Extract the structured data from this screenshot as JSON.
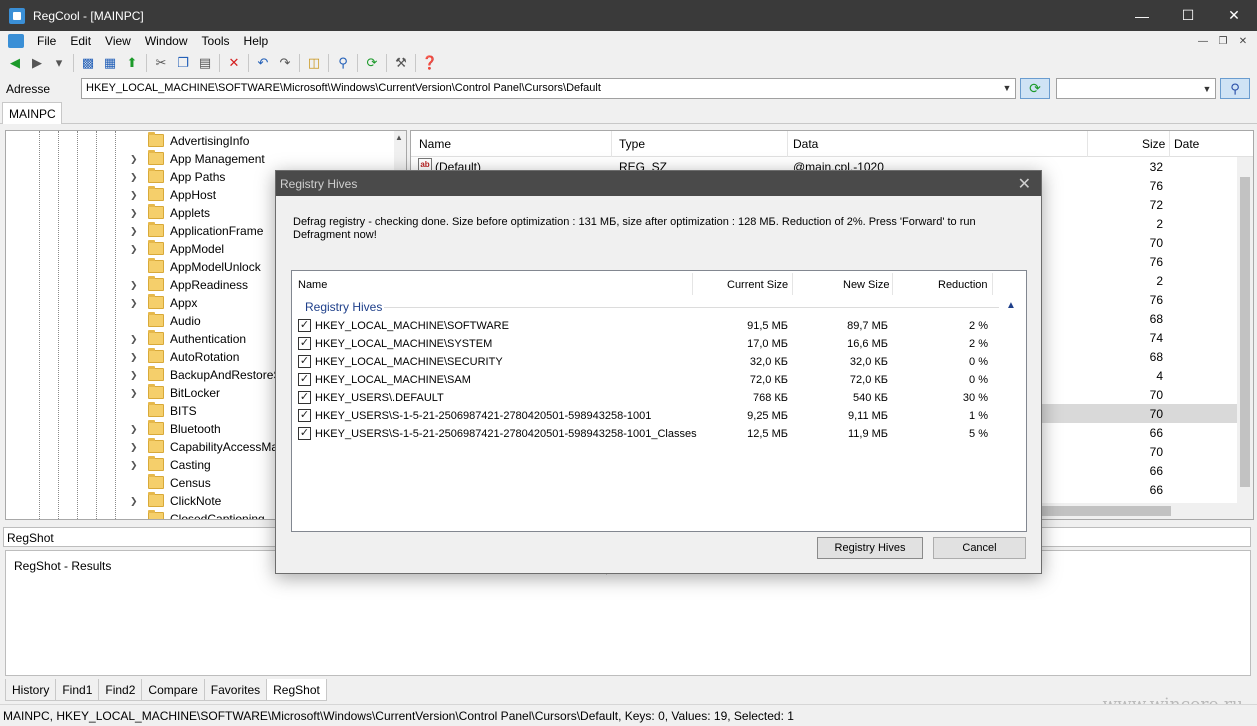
{
  "window": {
    "title": "RegCool - [MAINPC]",
    "controls": [
      "minimize-icon",
      "maximize-icon",
      "close-icon"
    ]
  },
  "menu": {
    "items": [
      "File",
      "Edit",
      "View",
      "Window",
      "Tools",
      "Help"
    ]
  },
  "address": {
    "label": "Adresse",
    "value": "HKEY_LOCAL_MACHINE\\SOFTWARE\\Microsoft\\Windows\\CurrentVersion\\Control Panel\\Cursors\\Default",
    "search_value": ""
  },
  "doc_tab": "MAINPC",
  "tree": {
    "items": [
      {
        "label": "AdvertisingInfo",
        "expandable": false
      },
      {
        "label": "App Management",
        "expandable": true
      },
      {
        "label": "App Paths",
        "expandable": true
      },
      {
        "label": "AppHost",
        "expandable": true
      },
      {
        "label": "Applets",
        "expandable": true
      },
      {
        "label": "ApplicationFrame",
        "expandable": true
      },
      {
        "label": "AppModel",
        "expandable": true
      },
      {
        "label": "AppModelUnlock",
        "expandable": false
      },
      {
        "label": "AppReadiness",
        "expandable": true
      },
      {
        "label": "Appx",
        "expandable": true
      },
      {
        "label": "Audio",
        "expandable": false
      },
      {
        "label": "Authentication",
        "expandable": true
      },
      {
        "label": "AutoRotation",
        "expandable": true
      },
      {
        "label": "BackupAndRestoreSe",
        "expandable": true
      },
      {
        "label": "BitLocker",
        "expandable": true
      },
      {
        "label": "BITS",
        "expandable": false
      },
      {
        "label": "Bluetooth",
        "expandable": true
      },
      {
        "label": "CapabilityAccessMan",
        "expandable": true
      },
      {
        "label": "Casting",
        "expandable": true
      },
      {
        "label": "Census",
        "expandable": false
      },
      {
        "label": "ClickNote",
        "expandable": true
      },
      {
        "label": "ClosedCaptioning",
        "expandable": false
      }
    ]
  },
  "values": {
    "columns": {
      "name": "Name",
      "type": "Type",
      "data": "Data",
      "size": "Size",
      "date": "Date"
    },
    "first_row": {
      "name": "(Default)",
      "type": "REG_SZ",
      "data": "@main.cpl,-1020"
    },
    "sizes": [
      "32",
      "76",
      "72",
      "2",
      "70",
      "76",
      "2",
      "76",
      "68",
      "74",
      "68",
      "4",
      "70",
      "70",
      "66",
      "70",
      "66",
      "66"
    ],
    "selected_index": 13
  },
  "regshot": {
    "title": "RegShot",
    "results_label": "RegShot - Results"
  },
  "bottom_tabs": [
    "History",
    "Find1",
    "Find2",
    "Compare",
    "Favorites",
    "RegShot"
  ],
  "active_bottom_tab": "RegShot",
  "status": "MAINPC, HKEY_LOCAL_MACHINE\\SOFTWARE\\Microsoft\\Windows\\CurrentVersion\\Control Panel\\Cursors\\Default, Keys: 0, Values: 19, Selected: 1",
  "watermark": "www.wincore.ru",
  "dialog": {
    "title": "Registry Hives",
    "message": "Defrag registry - checking done. Size before optimization : 131 МБ, size after optimization : 128 МБ. Reduction of 2%. Press 'Forward' to run Defragment now!",
    "columns": {
      "name": "Name",
      "current": "Current Size",
      "new": "New Size",
      "reduction": "Reduction"
    },
    "group": "Registry Hives",
    "rows": [
      {
        "name": "HKEY_LOCAL_MACHINE\\SOFTWARE",
        "current": "91,5 МБ",
        "new": "89,7 МБ",
        "reduction": "2 %",
        "checked": true
      },
      {
        "name": "HKEY_LOCAL_MACHINE\\SYSTEM",
        "current": "17,0 МБ",
        "new": "16,6 МБ",
        "reduction": "2 %",
        "checked": true
      },
      {
        "name": "HKEY_LOCAL_MACHINE\\SECURITY",
        "current": "32,0 КБ",
        "new": "32,0 КБ",
        "reduction": "0 %",
        "checked": true
      },
      {
        "name": "HKEY_LOCAL_MACHINE\\SAM",
        "current": "72,0 КБ",
        "new": "72,0 КБ",
        "reduction": "0 %",
        "checked": true
      },
      {
        "name": "HKEY_USERS\\.DEFAULT",
        "current": "768 КБ",
        "new": "540 КБ",
        "reduction": "30 %",
        "checked": true
      },
      {
        "name": "HKEY_USERS\\S-1-5-21-2506987421-2780420501-598943258-1001",
        "current": "9,25 МБ",
        "new": "9,11 МБ",
        "reduction": "1 %",
        "checked": true
      },
      {
        "name": "HKEY_USERS\\S-1-5-21-2506987421-2780420501-598943258-1001_Classes",
        "current": "12,5 МБ",
        "new": "11,9 МБ",
        "reduction": "5 %",
        "checked": true
      }
    ],
    "primary_button": "Registry Hives",
    "cancel_button": "Cancel"
  }
}
